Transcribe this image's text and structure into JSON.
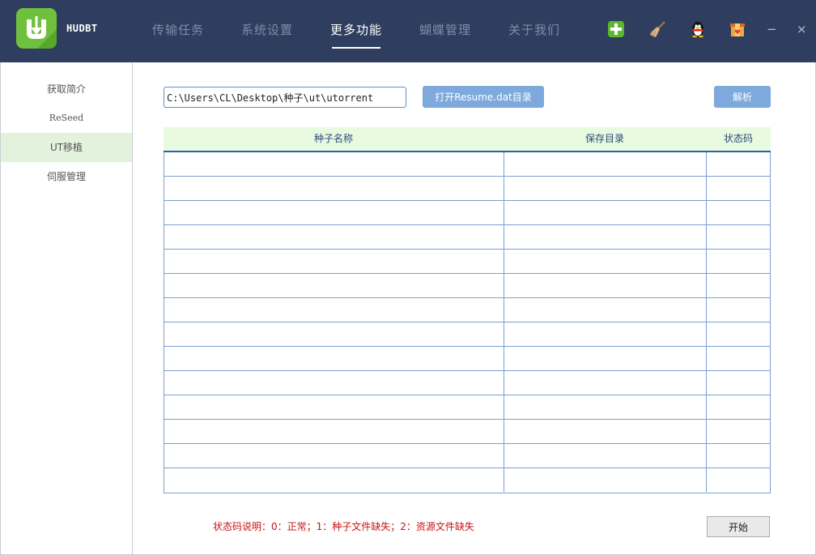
{
  "app": {
    "name": "HUDBT"
  },
  "nav": {
    "tabs": [
      {
        "label": "传输任务"
      },
      {
        "label": "系统设置"
      },
      {
        "label": "更多功能"
      },
      {
        "label": "蝴蝶管理"
      },
      {
        "label": "关于我们"
      }
    ],
    "active_tab": "更多功能"
  },
  "header_icons": [
    "add-icon",
    "broom-icon",
    "qq-penguin-icon",
    "gift-box-icon"
  ],
  "window_controls": {
    "minimize": "−",
    "close": "×"
  },
  "sidebar": {
    "items": [
      {
        "label": "获取简介"
      },
      {
        "label": "ReSeed"
      },
      {
        "label": "UT移植"
      },
      {
        "label": "伺服管理"
      }
    ],
    "active_item": "UT移植"
  },
  "toolbar": {
    "path_value": "C:\\Users\\CL\\Desktop\\种子\\ut\\utorrent",
    "open_button": "打开Resume.dat目录",
    "parse_button": "解析"
  },
  "table": {
    "columns": [
      "种子名称",
      "保存目录",
      "状态码"
    ],
    "rows": [
      [
        "",
        "",
        ""
      ],
      [
        "",
        "",
        ""
      ],
      [
        "",
        "",
        ""
      ],
      [
        "",
        "",
        ""
      ],
      [
        "",
        "",
        ""
      ],
      [
        "",
        "",
        ""
      ],
      [
        "",
        "",
        ""
      ],
      [
        "",
        "",
        ""
      ],
      [
        "",
        "",
        ""
      ],
      [
        "",
        "",
        ""
      ],
      [
        "",
        "",
        ""
      ],
      [
        "",
        "",
        ""
      ],
      [
        "",
        "",
        ""
      ],
      [
        "",
        "",
        ""
      ]
    ]
  },
  "footer": {
    "legend": "状态码说明：0：正常；1：种子文件缺失；2：资源文件缺失",
    "start_button": "开始"
  },
  "colors": {
    "header_bg": "#2f3e5f",
    "accent_green": "#6fc03c",
    "button_blue": "#7ea9dc",
    "sidebar_active": "#e2f2dc",
    "table_header_bg": "#e8fadf",
    "legend_red": "#cc1010"
  }
}
